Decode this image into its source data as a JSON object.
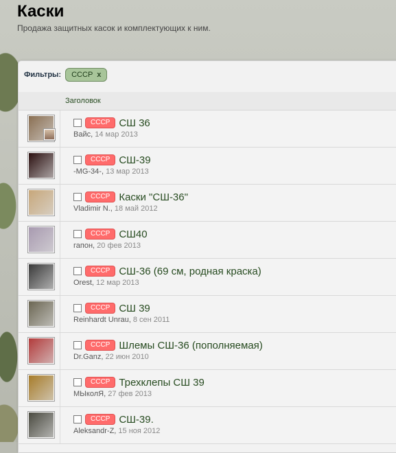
{
  "page": {
    "title": "Каски",
    "subtitle": "Продажа защитных касок и комплектующих к ним."
  },
  "filters": {
    "label": "Фильтры:",
    "active": "СССР",
    "remove_glyph": "x"
  },
  "columns": {
    "title_header": "Заголовок"
  },
  "threads": [
    {
      "prefix": "СССР",
      "title": "СШ 36",
      "author": "Вайс",
      "date": "14 мар 2013",
      "avatar_color": "#8a6f52"
    },
    {
      "prefix": "СССР",
      "title": "СШ-39",
      "author": "-MG-34-",
      "date": "13 мар 2013",
      "avatar_color": "#2b1010"
    },
    {
      "prefix": "СССР",
      "title": "Каски \"СШ-36\"",
      "author": "Vladimir N.",
      "date": "18 май 2012",
      "avatar_color": "#c7a77a"
    },
    {
      "prefix": "СССР",
      "title": "СШ40",
      "author": "гапон",
      "date": "20 фев 2013",
      "avatar_color": "#a89ab0"
    },
    {
      "prefix": "СССР",
      "title": "СШ-36 (69 см, родная краска)",
      "author": "Orest",
      "date": "12 мар 2013",
      "avatar_color": "#3a3a3a"
    },
    {
      "prefix": "СССР",
      "title": "СШ 39",
      "author": "Reinhardt Unrau",
      "date": "8 сен 2011",
      "avatar_color": "#6b6652"
    },
    {
      "prefix": "СССР",
      "title": "Шлемы СШ-36 (пополняемая)",
      "author": "Dr.Ganz",
      "date": "22 июн 2010",
      "avatar_color": "#b23b3b"
    },
    {
      "prefix": "СССР",
      "title": "Трехклепы СШ 39",
      "author": "МЫколЯ",
      "date": "27 фев 2013",
      "avatar_color": "#a77c2a"
    },
    {
      "prefix": "СССР",
      "title": "СШ-39.",
      "author": "Aleksandr-Z",
      "date": "15 ноя 2012",
      "avatar_color": "#4a4a40"
    }
  ]
}
